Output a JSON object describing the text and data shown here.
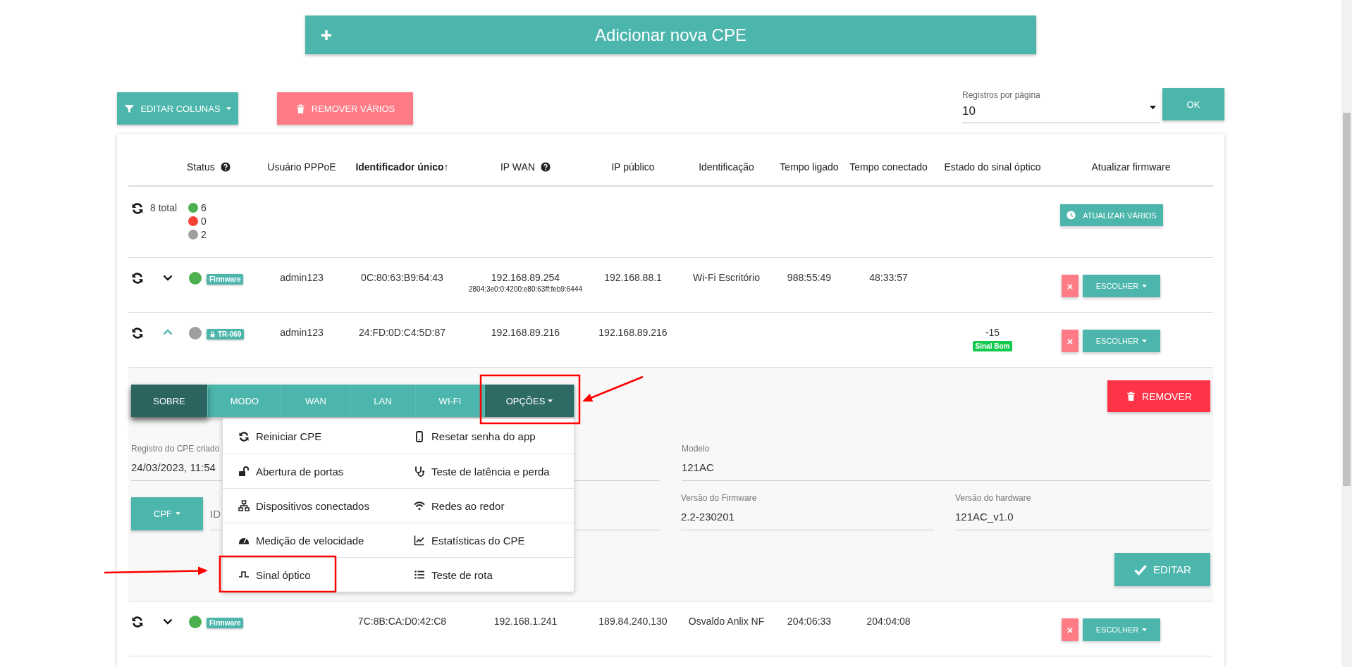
{
  "add_button": {
    "label": "Adicionar nova CPE"
  },
  "toolbar": {
    "edit_columns": {
      "label": "EDITAR COLUNAS"
    },
    "remove_many": {
      "label": "REMOVER VÁRIOS"
    },
    "per_page": {
      "label": "Registros por página",
      "value": "10"
    },
    "ok": {
      "label": "OK"
    }
  },
  "table": {
    "columns": [
      {
        "label": "Status",
        "help": true,
        "sorted": false
      },
      {
        "label": "Usuário PPPoE",
        "help": false,
        "sorted": false
      },
      {
        "label": "Identificador único↑",
        "help": false,
        "sorted": true
      },
      {
        "label": "IP WAN",
        "help": true,
        "sorted": false
      },
      {
        "label": "IP público",
        "help": false,
        "sorted": false
      },
      {
        "label": "Identificação",
        "help": false,
        "sorted": false
      },
      {
        "label": "Tempo ligado",
        "help": false,
        "sorted": false
      },
      {
        "label": "Tempo conectado",
        "help": false,
        "sorted": false
      },
      {
        "label": "Estado do sinal óptico",
        "help": false,
        "sorted": false
      },
      {
        "label": "Atualizar firmware",
        "help": false,
        "sorted": false
      }
    ],
    "summary": {
      "total": "8 total",
      "counts": [
        {
          "value": "6",
          "color": "#4caf50"
        },
        {
          "value": "0",
          "color": "#f44336"
        },
        {
          "value": "2",
          "color": "#9e9e9e"
        }
      ],
      "update_many": "ATUALIZAR VÁRIOS"
    },
    "rows": [
      {
        "expanded": false,
        "color": "#4caf50",
        "badge": {
          "label": "Firmware",
          "locked": false
        },
        "pppoe": "admin123",
        "id": "0C:80:63:B9:64:43",
        "ip_wan": "192.168.89.254",
        "ipv6": "2804:3e0:0:4200:e80:63ff:feb9:6444",
        "ip_public": "192.168.88.1",
        "identification": "Wi-Fi Escritório",
        "uptime": "988:55:49",
        "connected": "48:33:57",
        "actions": {
          "remove": "×",
          "choose": "ESCOLHER"
        }
      },
      {
        "expanded": true,
        "color": "#9e9e9e",
        "badge": {
          "label": "TR-069",
          "locked": true
        },
        "pppoe": "admin123",
        "id": "24:FD:0D:C4:5D:87",
        "ip_wan": "192.168.89.216",
        "ip_public": "192.168.89.216",
        "signal": {
          "value": "-15",
          "label": "Sinal Bom"
        },
        "actions": {
          "remove": "×",
          "choose": "ESCOLHER"
        },
        "details": {
          "tabs": [
            {
              "label": "SOBRE",
              "kind": "tab",
              "selected": true
            },
            {
              "label": "MODO",
              "kind": "tab",
              "selected": false
            },
            {
              "label": "WAN",
              "kind": "tab",
              "selected": false
            },
            {
              "label": "LAN",
              "kind": "tab",
              "selected": false
            },
            {
              "label": "WI-FI",
              "kind": "tab",
              "selected": false
            },
            {
              "label": "OPÇÕES",
              "kind": "dropdown",
              "selected": false,
              "open": true
            }
          ],
          "menu": [
            {
              "label": "Reiniciar CPE"
            },
            {
              "label": "Resetar senha do app"
            },
            {
              "label": "Abertura de portas"
            },
            {
              "label": "Teste de latência e perda"
            },
            {
              "label": "Dispositivos conectados"
            },
            {
              "label": "Redes ao redor"
            },
            {
              "label": "Medição de velocidade"
            },
            {
              "label": "Estatísticas do CPE"
            },
            {
              "label": "Sinal óptico"
            },
            {
              "label": "Teste de rota"
            }
          ],
          "remove": "REMOVER",
          "fields": [
            {
              "label": "Registro do CPE criado",
              "value": "24/03/2023, 11:54"
            },
            {
              "label": "Modelo",
              "value": "121AC"
            }
          ],
          "id_type": "CPF",
          "id_field": {
            "placeholder": "ID"
          },
          "versions": [
            {
              "label": "Versão do Firmware",
              "value": "2.2-230201"
            },
            {
              "label": "Versão do hardware",
              "value": "121AC_v1.0"
            }
          ],
          "edit": "EDITAR"
        }
      },
      {
        "expanded": false,
        "color": "#4caf50",
        "badge": {
          "label": "Firmware",
          "locked": false
        },
        "id": "7C:8B:CA:D0:42:C8",
        "ip_wan": "192.168.1.241",
        "ip_public": "189.84.240.130",
        "identification": "Osvaldo Anlix NF",
        "uptime": "204:06:33",
        "connected": "204:04:08",
        "actions": {
          "remove": "×",
          "choose": "ESCOLHER"
        }
      }
    ]
  }
}
